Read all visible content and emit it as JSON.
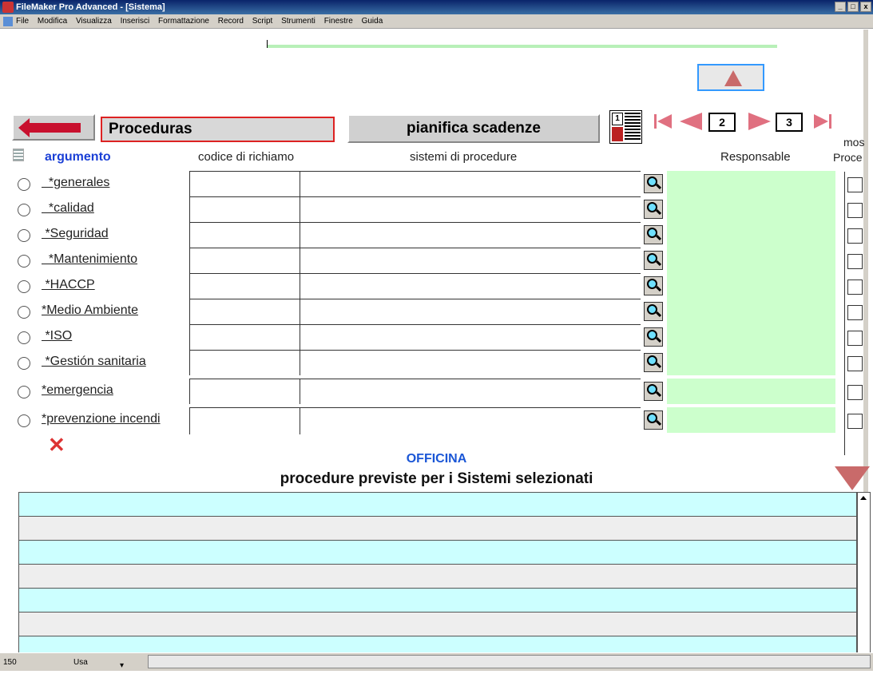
{
  "window": {
    "title": "FileMaker Pro Advanced - [Sistema]",
    "buttons": [
      "_",
      "□",
      "x"
    ]
  },
  "menu": {
    "items": [
      "File",
      "Modifica",
      "Visualizza",
      "Inserisci",
      "Formattazione",
      "Record",
      "Script",
      "Strumenti",
      "Finestre",
      "Guida"
    ]
  },
  "header": {
    "proc_title": "Proceduras",
    "plan_button": "pianifica scadenze",
    "page_current": "2",
    "page_total": "3"
  },
  "columns": {
    "argomento": "argumento",
    "codice": "codice di richiamo",
    "sistemi": "sistemi di procedure",
    "responsabile": "Responsable",
    "mostra_1": "mos",
    "mostra_2": "Proce"
  },
  "rows": [
    {
      "label": "  *generales"
    },
    {
      "label": "  *calidad"
    },
    {
      "label": " *Seguridad"
    },
    {
      "label": "  *Mantenimiento"
    },
    {
      "label": " *HACCP"
    },
    {
      "label": "*Medio Ambiente"
    },
    {
      "label": " *ISO"
    },
    {
      "label": " *Gestión sanitaria"
    },
    {
      "label": "*emergencia"
    },
    {
      "label": "*prevenzione incendi"
    }
  ],
  "section": {
    "title": "OFFICINA",
    "subtitle": "procedure previste per i Sistemi selezionati"
  },
  "status": {
    "zoom": "150",
    "mode": "Usa"
  },
  "colors": {
    "accent_red": "#c8102e",
    "responsabile_bg": "#ccffcc",
    "portal_cyan": "#ccffff"
  }
}
